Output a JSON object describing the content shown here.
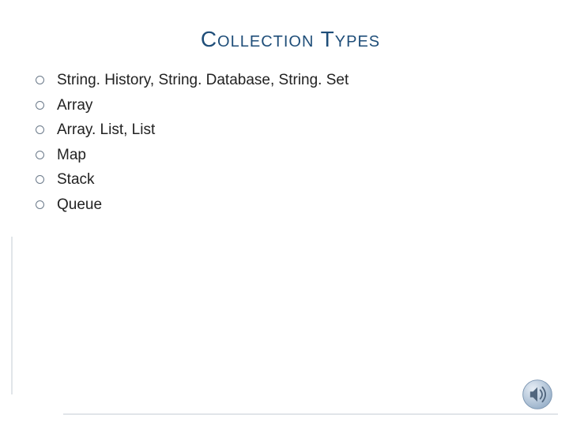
{
  "title": "Collection Types",
  "bullets": [
    "String. History, String. Database, String. Set",
    "Array",
    "Array. List, List",
    "Map",
    "Stack",
    "Queue"
  ],
  "icon_name": "speaker-icon"
}
